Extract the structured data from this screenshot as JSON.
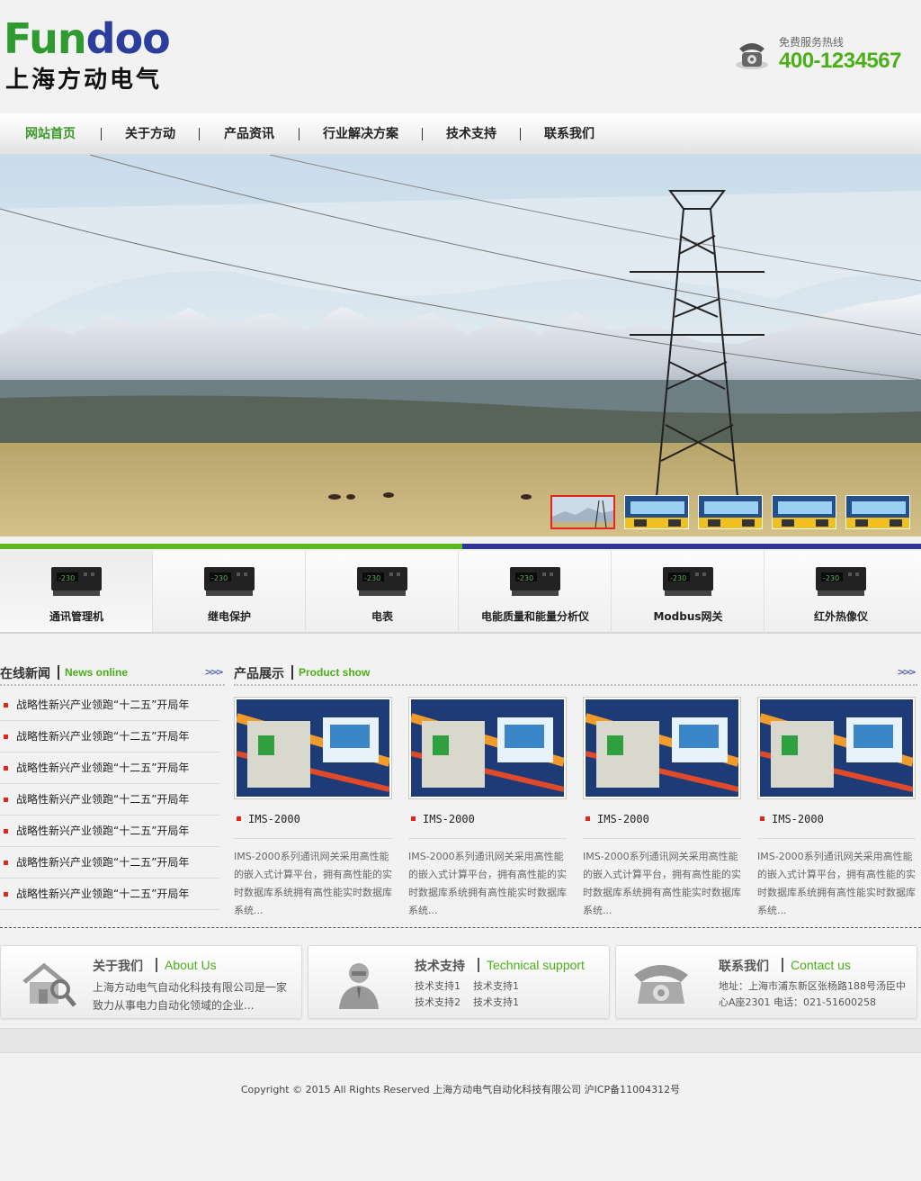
{
  "brand": {
    "logo_part1": "Fun",
    "logo_part2": "doo",
    "name_cn": "上海方动电气",
    "hotline_label": "免费服务热线",
    "hotline_number": "400-1234567"
  },
  "nav": {
    "items": [
      {
        "label": "网站首页",
        "active": true
      },
      {
        "label": "关于方动"
      },
      {
        "label": "产品资讯"
      },
      {
        "label": "行业解决方案"
      },
      {
        "label": "技术支持"
      },
      {
        "label": "联系我们"
      }
    ]
  },
  "categories": [
    {
      "label": "通讯管理机",
      "active": true
    },
    {
      "label": "继电保护"
    },
    {
      "label": "电表"
    },
    {
      "label": "电能质量和能量分析仪"
    },
    {
      "label": "Modbus网关"
    },
    {
      "label": "红外热像仪"
    }
  ],
  "news": {
    "title": "在线新闻",
    "title_en": "News online",
    "more": ">>>",
    "items": [
      "战略性新兴产业领跑“十二五”开局年",
      "战略性新兴产业领跑“十二五”开局年",
      "战略性新兴产业领跑“十二五”开局年",
      "战略性新兴产业领跑“十二五”开局年",
      "战略性新兴产业领跑“十二五”开局年",
      "战略性新兴产业领跑“十二五”开局年",
      "战略性新兴产业领跑“十二五”开局年"
    ]
  },
  "products": {
    "title": "产品展示",
    "title_en": "Product show",
    "more": ">>>",
    "items": [
      {
        "name": "IMS-2000",
        "desc": "IMS-2000系列通讯网关采用高性能的嵌入式计算平台，拥有高性能的实时数据库系统拥有高性能实时数据库系统..."
      },
      {
        "name": "IMS-2000",
        "desc": "IMS-2000系列通讯网关采用高性能的嵌入式计算平台，拥有高性能的实时数据库系统拥有高性能实时数据库系统..."
      },
      {
        "name": "IMS-2000",
        "desc": "IMS-2000系列通讯网关采用高性能的嵌入式计算平台，拥有高性能的实时数据库系统拥有高性能实时数据库系统..."
      },
      {
        "name": "IMS-2000",
        "desc": "IMS-2000系列通讯网关采用高性能的嵌入式计算平台，拥有高性能的实时数据库系统拥有高性能实时数据库系统..."
      }
    ]
  },
  "about": {
    "title": "关于我们",
    "title_en": "About Us",
    "text": "上海方动电气自动化科技有限公司是一家致力从事电力自动化领域的企业..."
  },
  "support": {
    "title": "技术支持",
    "title_en": "Technical support",
    "links": [
      "技术支持1",
      "技术支持1",
      "技术支持2",
      "技术支持1"
    ]
  },
  "contact": {
    "title": "联系我们",
    "title_en": "Contact us",
    "text": "地址：上海市浦东新区张杨路188号汤臣中心A座2301 电话：021-51600258"
  },
  "footer": {
    "copyright": "Copyright © 2015 All Rights Reserved 上海方动电气自动化科技有限公司    沪ICP备11004312号"
  },
  "colors": {
    "green": "#4caf18",
    "blue": "#2f3596",
    "red_bullet": "#e0261d"
  },
  "icons": [
    "phone-icon",
    "house-search-icon",
    "person-icon",
    "telephone-icon",
    "device-icon"
  ]
}
